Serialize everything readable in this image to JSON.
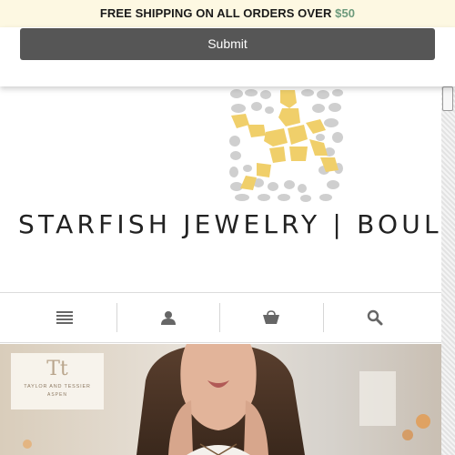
{
  "announcement": {
    "text": "FREE SHIPPING ON ALL ORDERS OVER ",
    "amount": "$50"
  },
  "form": {
    "submit_label": "Submit"
  },
  "brand": {
    "name": "STARFISH JEWELRY | BOULDER"
  },
  "nav": {
    "items": [
      {
        "icon": "menu-icon"
      },
      {
        "icon": "account-icon"
      },
      {
        "icon": "cart-icon"
      },
      {
        "icon": "search-icon"
      }
    ]
  },
  "hero": {
    "partner_monogram": "Tt",
    "partner_name": "TAYLOR AND TESSIER",
    "partner_city": "ASPEN"
  },
  "colors": {
    "announcement_bg": "#fdf8e2",
    "amount": "#6c9a7c",
    "submit_bg": "#565656",
    "logo_yellow": "#f0cf6a",
    "logo_gray": "#c9c9c9"
  }
}
